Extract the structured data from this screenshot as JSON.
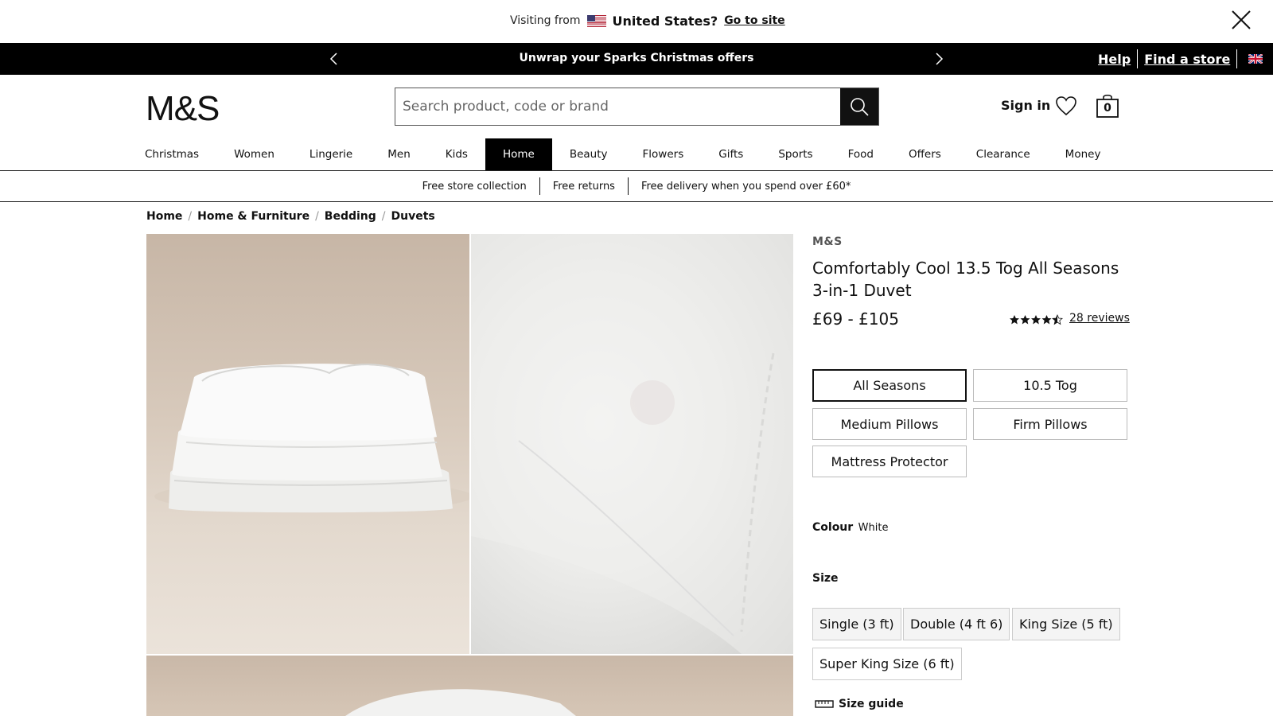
{
  "geo_banner": {
    "visiting_label": "Visiting from",
    "country": "United States?",
    "go_link": "Go to site"
  },
  "promo_bar": {
    "message": "Unwrap your Sparks Christmas offers",
    "help": "Help",
    "find_store": "Find a store"
  },
  "header": {
    "logo": "M&S",
    "search_placeholder": "Search product, code or brand",
    "sign_in": "Sign in",
    "bag_count": "0"
  },
  "nav": {
    "items": [
      "Christmas",
      "Women",
      "Lingerie",
      "Men",
      "Kids",
      "Home",
      "Beauty",
      "Flowers",
      "Gifts",
      "Sports",
      "Food",
      "Offers",
      "Clearance",
      "Money"
    ],
    "active": "Home"
  },
  "perks": [
    "Free store collection",
    "Free returns",
    "Free delivery when you spend over £60*"
  ],
  "breadcrumb": [
    "Home",
    "Home & Furniture",
    "Bedding",
    "Duvets"
  ],
  "product": {
    "brand": "M&S",
    "title": "Comfortably Cool 13.5 Tog All Seasons 3-in-1 Duvet",
    "price": "£69 - £105",
    "rating": 4.5,
    "reviews": "28 reviews",
    "options": [
      "All Seasons",
      "10.5 Tog",
      "Medium Pillows",
      "Firm Pillows",
      "Mattress Protector"
    ],
    "selected_option": "All Seasons",
    "colour_label": "Colour",
    "colour_value": "White",
    "size_label": "Size",
    "sizes": [
      "Single (3 ft)",
      "Double (4 ft 6)",
      "King Size (5 ft)",
      "Super King Size (6 ft)"
    ],
    "size_guide": "Size guide"
  },
  "colors": {
    "black": "#000000",
    "text": "#111111"
  }
}
